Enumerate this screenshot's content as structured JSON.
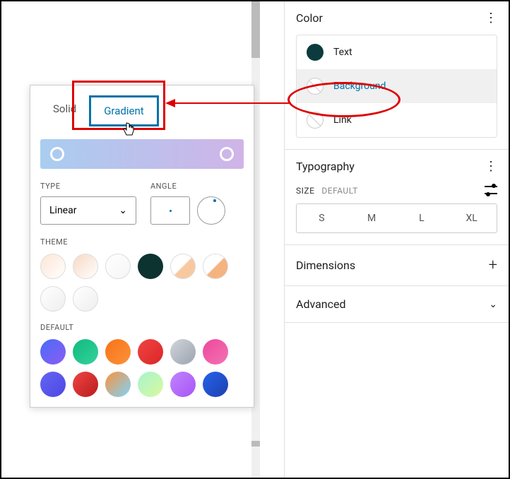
{
  "sidebar": {
    "color": {
      "title": "Color",
      "items": [
        {
          "label": "Text",
          "filled": true,
          "active": false
        },
        {
          "label": "Background",
          "filled": false,
          "active": true
        },
        {
          "label": "Link",
          "filled": false,
          "active": false
        }
      ]
    },
    "typography": {
      "title": "Typography",
      "size_label": "SIZE",
      "size_secondary": "DEFAULT",
      "sizes": [
        "S",
        "M",
        "L",
        "XL"
      ]
    },
    "dimensions": {
      "title": "Dimensions"
    },
    "advanced": {
      "title": "Advanced"
    }
  },
  "popover": {
    "tabs": {
      "solid": "Solid",
      "gradient": "Gradient",
      "active": "gradient"
    },
    "type": {
      "label": "TYPE",
      "value": "Linear"
    },
    "angle": {
      "label": "ANGLE"
    },
    "theme": {
      "label": "THEME",
      "swatches": [
        "linear-gradient(135deg,#fce5d5,#fff)",
        "linear-gradient(135deg,#f8d8c3,#fff)",
        "linear-gradient(135deg,#fff,#f5f5f5)",
        "#0c3330",
        "linear-gradient(135deg,#fff 48%,#f8c9a0 52%)",
        "linear-gradient(135deg,#fff 48%,#f5b380 52%)",
        "linear-gradient(135deg,#fff,#eee)",
        "linear-gradient(135deg,#fff,#eee)"
      ]
    },
    "default": {
      "label": "DEFAULT",
      "swatches": [
        "linear-gradient(135deg,#4a6cf7,#8b5cf6)",
        "linear-gradient(135deg,#10b981,#34d399)",
        "linear-gradient(135deg,#f97316,#fb923c)",
        "linear-gradient(135deg,#ef4444,#dc2626)",
        "linear-gradient(135deg,#d1d5db,#9ca3af)",
        "linear-gradient(135deg,#ec4899,#f472b6)",
        "linear-gradient(135deg,#6366f1,#4f46e5)",
        "linear-gradient(135deg,#ef4444,#b91c1c)",
        "linear-gradient(135deg,#fb923c,#7dd3fc)",
        "linear-gradient(135deg,#a7f3d0,#d9f99d)",
        "linear-gradient(135deg,#c084fc,#a855f7)",
        "linear-gradient(135deg,#2563eb,#1e40af)"
      ]
    }
  }
}
